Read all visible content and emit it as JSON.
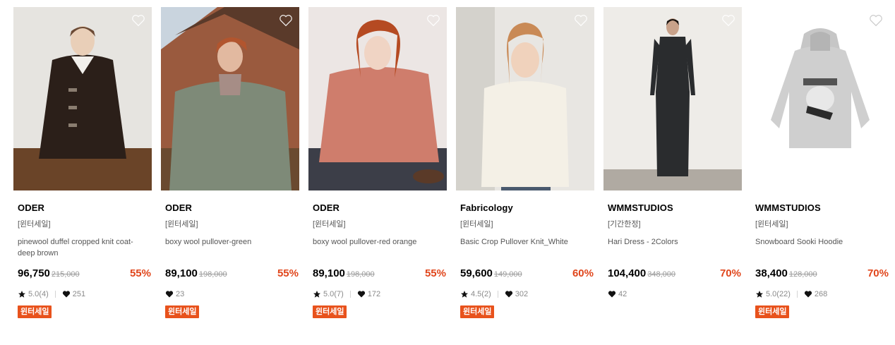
{
  "products": [
    {
      "brand": "ODER",
      "tag": "[윈터세일]",
      "name": "pinewool duffel cropped knit coat-deep brown",
      "price": "96,750",
      "orig": "215,000",
      "disc": "55%",
      "rating": "5.0(4)",
      "likes": "251",
      "badge": "윈터세일",
      "photo_desc": "brown-coat"
    },
    {
      "brand": "ODER",
      "tag": "[윈터세일]",
      "name": "boxy wool pullover-green",
      "price": "89,100",
      "orig": "198,000",
      "disc": "55%",
      "rating": "",
      "likes": "23",
      "badge": "윈터세일",
      "photo_desc": "green-pullover"
    },
    {
      "brand": "ODER",
      "tag": "[윈터세일]",
      "name": "boxy wool pullover-red orange",
      "price": "89,100",
      "orig": "198,000",
      "disc": "55%",
      "rating": "5.0(7)",
      "likes": "172",
      "badge": "윈터세일",
      "photo_desc": "red-pullover"
    },
    {
      "brand": "Fabricology",
      "tag": "[윈터세일]",
      "name": "Basic Crop Pullover Knit_White",
      "price": "59,600",
      "orig": "149,000",
      "disc": "60%",
      "rating": "4.5(2)",
      "likes": "302",
      "badge": "윈터세일",
      "photo_desc": "white-knit"
    },
    {
      "brand": "WMMSTUDIOS",
      "tag": "[기간한정]",
      "name": "Hari Dress - 2Colors",
      "price": "104,400",
      "orig": "348,000",
      "disc": "70%",
      "rating": "",
      "likes": "42",
      "badge": "",
      "photo_desc": "black-dress"
    },
    {
      "brand": "WMMSTUDIOS",
      "tag": "[윈터세일]",
      "name": "Snowboard Sooki Hoodie",
      "price": "38,400",
      "orig": "128,000",
      "disc": "70%",
      "rating": "5.0(22)",
      "likes": "268",
      "badge": "윈터세일",
      "photo_desc": "grey-hoodie"
    }
  ],
  "colors": {
    "discount": "#e0461c",
    "badge_bg": "#e8521c"
  },
  "icons": {
    "wishlist": "heart-outline-icon",
    "rating": "star-icon",
    "likes": "heart-icon"
  }
}
